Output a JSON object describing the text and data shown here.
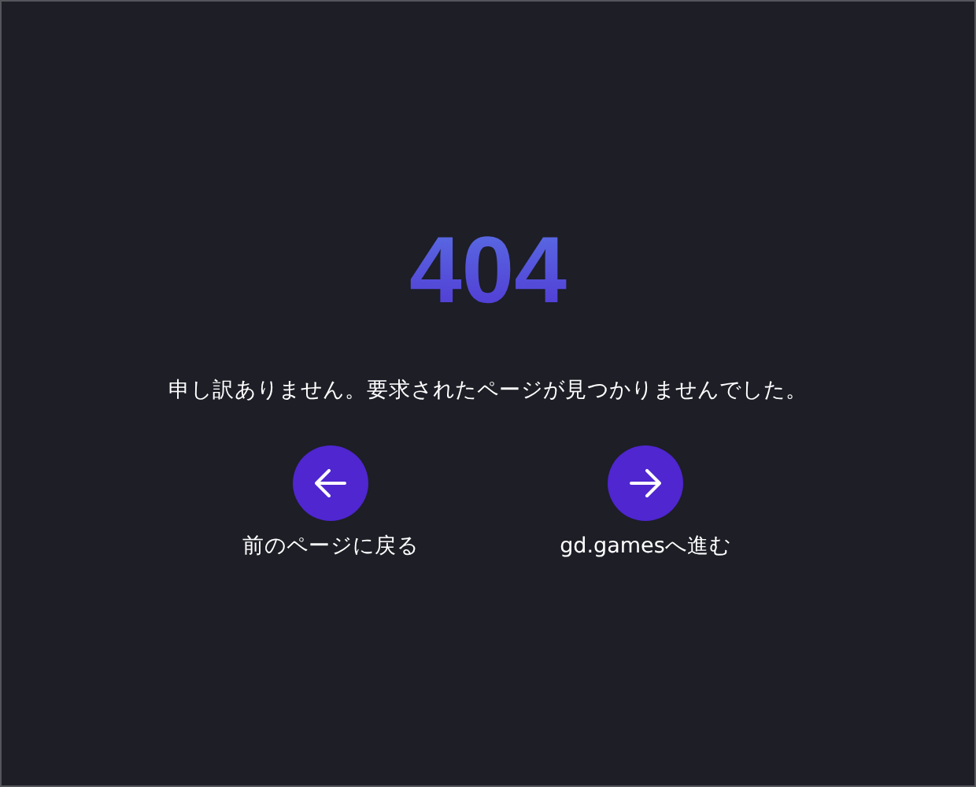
{
  "error": {
    "code": "404",
    "message": "申し訳ありません。要求されたページが見つかりませんでした。"
  },
  "actions": [
    {
      "kind": "back",
      "label": "前のページに戻る"
    },
    {
      "kind": "forward",
      "label": "gd.gamesへ進む"
    }
  ]
}
